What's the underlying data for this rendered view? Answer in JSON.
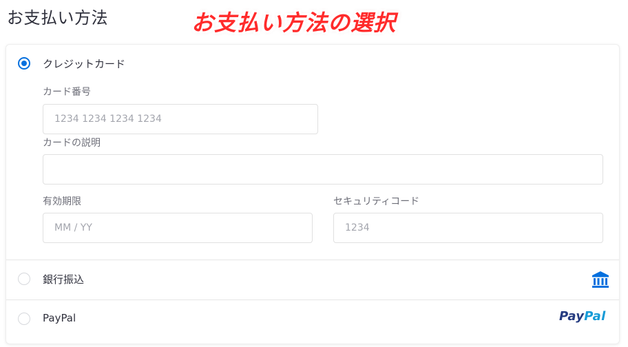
{
  "page": {
    "title": "お支払い方法"
  },
  "annotation": {
    "text": "お支払い方法の選択"
  },
  "payment_options": {
    "credit_card": {
      "label": "クレジットカード",
      "selected": true,
      "card_number": {
        "label": "カード番号",
        "placeholder": "1234 1234 1234 1234"
      },
      "card_description": {
        "label": "カードの説明",
        "value": ""
      },
      "expiry": {
        "label": "有効期限",
        "placeholder": "MM / YY"
      },
      "security_code": {
        "label": "セキュリティコード",
        "placeholder": "1234"
      }
    },
    "bank_transfer": {
      "label": "銀行振込",
      "selected": false,
      "icon": "bank-icon"
    },
    "paypal": {
      "label": "PayPal",
      "selected": false,
      "logo_part1": "Pay",
      "logo_part2": "Pal"
    }
  },
  "colors": {
    "accent": "#0570de",
    "annotation": "#ff2b2b",
    "paypal_dark": "#253b80",
    "paypal_light": "#179bd7"
  }
}
